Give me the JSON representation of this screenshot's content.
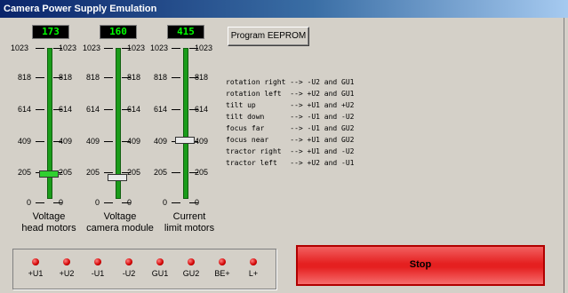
{
  "window": {
    "title": "Camera Power Supply Emulation"
  },
  "scales": {
    "top": "1023",
    "s818": "818",
    "s614": "614",
    "s409": "409",
    "s205": "205",
    "zero": "0"
  },
  "sliders": [
    {
      "display": "173",
      "caption1": "Voltage",
      "caption2": "head motors"
    },
    {
      "display": "160",
      "caption1": "Voltage",
      "caption2": "camera module"
    },
    {
      "display": "415",
      "caption1": "Current",
      "caption2": "limit motors"
    }
  ],
  "buttons": {
    "program_eeprom": "Program EEPROM",
    "stop": "Stop"
  },
  "descriptions": [
    "rotation right --> -U2 and GU1",
    "rotation left  --> +U2 and GU1",
    "tilt up        --> +U1 and +U2",
    "tilt down      --> -U1 and -U2",
    "focus far      --> -U1 and GU2",
    "focus near     --> +U1 and GU2",
    "tractor right  --> +U1 and -U2",
    "tractor left   --> +U2 and -U1"
  ],
  "leds": [
    "+U1",
    "+U2",
    "-U1",
    "-U2",
    "GU1",
    "GU2",
    "BE+",
    "L+"
  ],
  "colors": {
    "titlebar": "#0a246a",
    "lcd_text": "#00ff00",
    "stop_button": "#e52020",
    "led_on": "#d00000"
  }
}
